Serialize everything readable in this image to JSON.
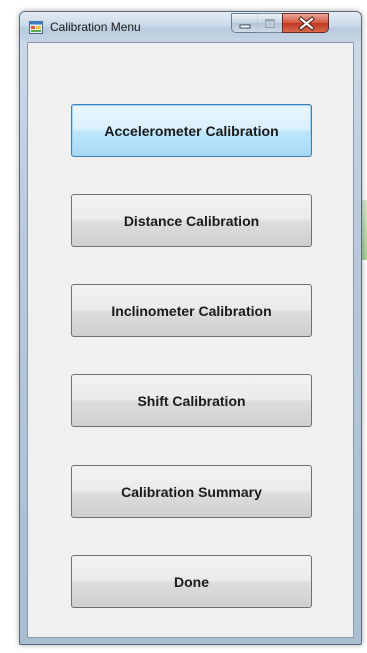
{
  "window": {
    "title": "Calibration Menu",
    "icons": {
      "app": "form-app-icon",
      "minimize": "minimize-icon",
      "maximize": "maximize-icon",
      "close": "close-icon"
    }
  },
  "buttons": [
    {
      "label": "Accelerometer Calibration",
      "state": "focused"
    },
    {
      "label": "Distance Calibration"
    },
    {
      "label": "Inclinometer Calibration"
    },
    {
      "label": "Shift Calibration"
    },
    {
      "label": "Calibration Summary"
    },
    {
      "label": "Done"
    }
  ],
  "colors": {
    "client_background": "#f0f0f0",
    "close_button": "#c0381f",
    "focused_button_border": "#3c7fb1"
  }
}
